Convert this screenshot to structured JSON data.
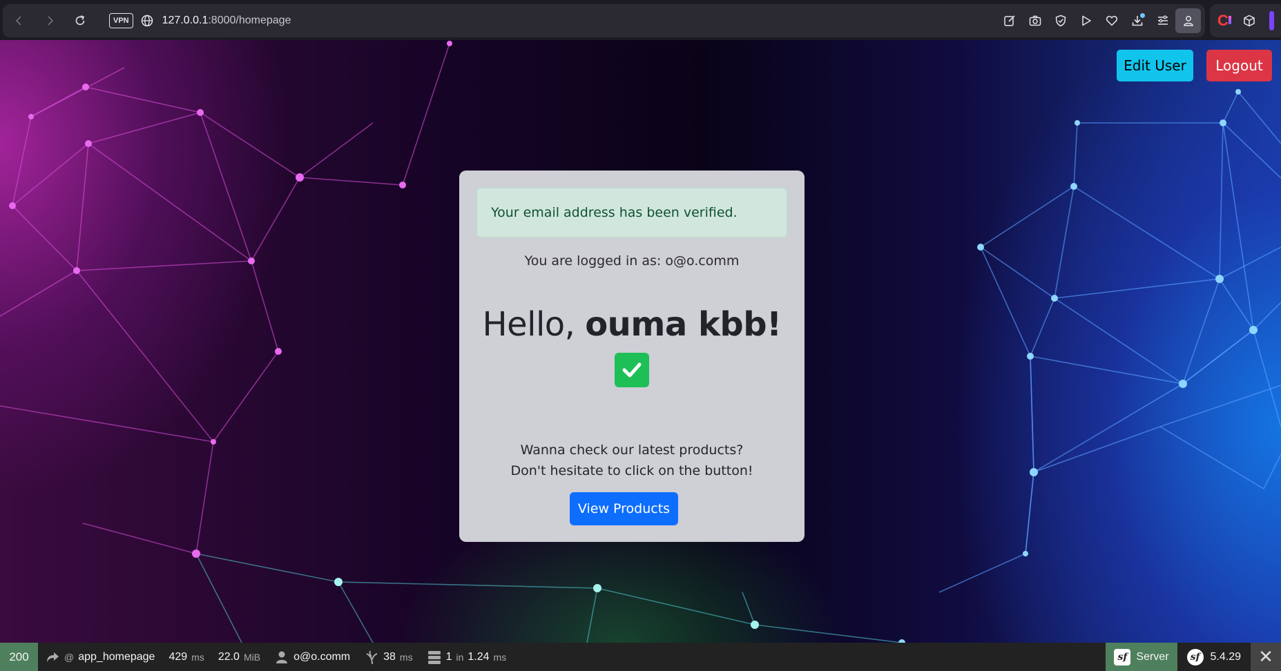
{
  "browser": {
    "url_host": "127.0.0.1",
    "url_rest": ":8000/homepage",
    "vpn_label": "VPN",
    "toolbar_icons": [
      "edit-icon",
      "camera-icon",
      "shield-icon",
      "play-icon",
      "heart-icon",
      "download-icon",
      "menu-icon",
      "profile-icon"
    ],
    "extension_icons": [
      "c-extension-icon",
      "cube-icon"
    ]
  },
  "header": {
    "edit_user_label": "Edit User",
    "logout_label": "Logout"
  },
  "card": {
    "alert_text": "Your email address has been verified.",
    "logged_in_text": "You are logged in as: o@o.comm",
    "greeting_prefix": "Hello, ",
    "greeting_name": "ouma kbb!",
    "promo_line1": "Wanna check our latest products?",
    "promo_line2": "Don't hesitate to click on the button!",
    "view_products_label": "View Products"
  },
  "colors": {
    "edit_button": "#11c4ec",
    "logout_button": "#dc3545",
    "view_button": "#0d6efd",
    "alert_bg": "#d1e7dd",
    "check_bg": "#1fbf57",
    "status_bg": "#4f805d"
  },
  "debug_toolbar": {
    "status_code": "200",
    "route_prefix": "@",
    "route": "app_homepage",
    "time_value": "429",
    "time_unit": "ms",
    "memory_value": "22.0",
    "memory_unit": "MiB",
    "user": "o@o.comm",
    "twig_value": "38",
    "twig_unit": "ms",
    "db_value": "1",
    "db_in": "in",
    "db_time": "1.24",
    "db_unit": "ms",
    "server_label": "Server",
    "version": "5.4.29"
  }
}
